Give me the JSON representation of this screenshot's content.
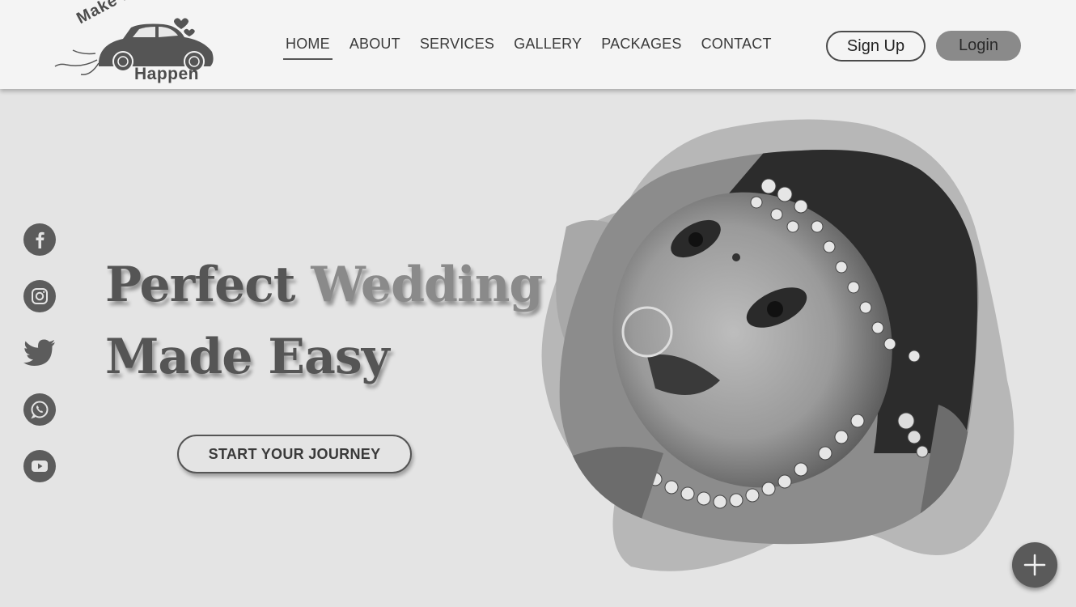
{
  "logo": {
    "top_text": "Make It",
    "bottom_text": "Happen"
  },
  "nav": {
    "items": [
      {
        "label": "HOME",
        "active": true
      },
      {
        "label": "ABOUT"
      },
      {
        "label": "SERVICES"
      },
      {
        "label": "GALLERY"
      },
      {
        "label": "PACKAGES"
      },
      {
        "label": "CONTACT"
      }
    ]
  },
  "auth": {
    "signup_label": "Sign Up",
    "login_label": "Login"
  },
  "social": {
    "icons": [
      "facebook-icon",
      "instagram-icon",
      "twitter-icon",
      "whatsapp-icon",
      "youtube-icon"
    ]
  },
  "hero": {
    "line1_dark": "Perfect",
    "line1_light": "Wedding",
    "line2": "Made Easy",
    "cta_label": "START YOUR JOURNEY"
  },
  "image": {
    "subject": "bride-portrait"
  },
  "fab": {
    "icon": "plus-icon"
  },
  "colors": {
    "background": "#e4e4e4",
    "header": "#f4f4f4",
    "accent_dark": "#555555",
    "accent_light": "#8a8a8a"
  }
}
